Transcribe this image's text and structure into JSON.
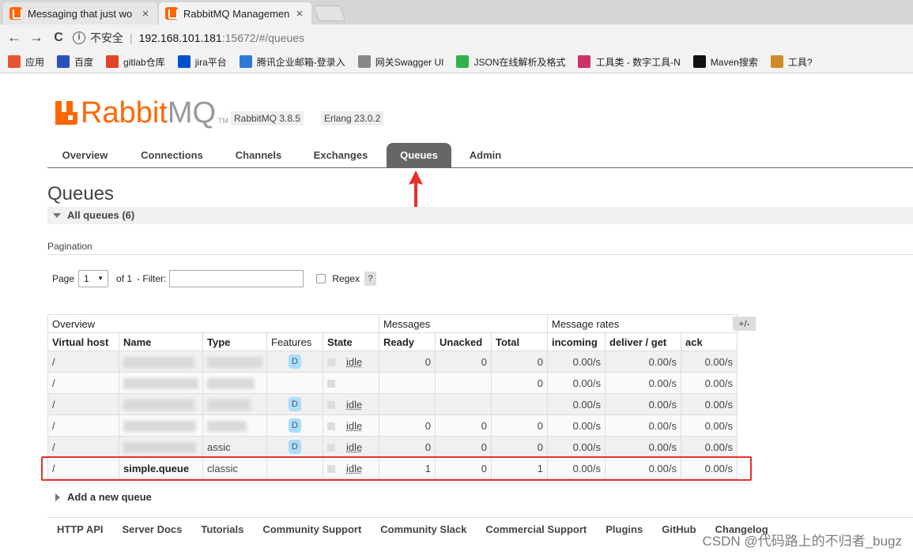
{
  "browser": {
    "tabs": [
      {
        "title": "Messaging that just wo",
        "active": false
      },
      {
        "title": "RabbitMQ Managemen",
        "active": true
      }
    ],
    "close_glyph": "×",
    "nav": {
      "back": "←",
      "forward": "→",
      "reload": "C"
    },
    "address": {
      "insecure_label": "不安全",
      "separator": "|",
      "host": "192.168.101.181",
      "rest": ":15672/#/queues"
    },
    "bookmarks": [
      {
        "label": "应用",
        "icon": "apps-grid-icon",
        "color": "#e8542f"
      },
      {
        "label": "百度",
        "icon": "paw-icon",
        "color": "#2a52be"
      },
      {
        "label": "gitlab仓库",
        "icon": "fox-icon",
        "color": "#e24329"
      },
      {
        "label": "jira平台",
        "icon": "jira-icon",
        "color": "#0052cc"
      },
      {
        "label": "腾讯企业邮箱-登录入",
        "icon": "mail-icon",
        "color": "#2e7bd6"
      },
      {
        "label": "网关Swagger UI",
        "icon": "document-icon",
        "color": "#888888"
      },
      {
        "label": "JSON在线解析及格式",
        "icon": "json-icon",
        "color": "#2fb24c"
      },
      {
        "label": "工具类 - 数字工具-N",
        "icon": "tool-icon",
        "color": "#cc3366"
      },
      {
        "label": "Maven搜索",
        "icon": "source-icon",
        "color": "#111111"
      },
      {
        "label": "工具?",
        "icon": "face-icon",
        "color": "#d08a2a"
      }
    ]
  },
  "app": {
    "brand_rabbit": "Rabbit",
    "brand_mq": "MQ",
    "brand_tm": "TM",
    "version_rabbitmq": "RabbitMQ 3.8.5",
    "version_erlang": "Erlang 23.0.2",
    "nav": [
      {
        "label": "Overview",
        "active": false
      },
      {
        "label": "Connections",
        "active": false
      },
      {
        "label": "Channels",
        "active": false
      },
      {
        "label": "Exchanges",
        "active": false
      },
      {
        "label": "Queues",
        "active": true
      },
      {
        "label": "Admin",
        "active": false
      }
    ],
    "page_title": "Queues",
    "section_title": "All queues (6)",
    "pagination": {
      "label": "Pagination",
      "page_label": "Page",
      "page_value": "1",
      "of_label": "of 1",
      "filter_label": "- Filter:",
      "filter_value": "",
      "regex_label": "Regex",
      "help_label": "?"
    },
    "table": {
      "group_headers": {
        "overview": "Overview",
        "messages": "Messages",
        "rates": "Message rates"
      },
      "columns": [
        "Virtual host",
        "Name",
        "Type",
        "Features",
        "State",
        "Ready",
        "Unacked",
        "Total",
        "incoming",
        "deliver / get",
        "ack"
      ],
      "toggle_label": "+/-",
      "rows": [
        {
          "vhost": "/",
          "name": "",
          "type": "",
          "feature": "D",
          "state": "idle",
          "ready": "0",
          "unacked": "0",
          "total": "0",
          "incoming": "0.00/s",
          "deliver": "0.00/s",
          "ack": "0.00/s"
        },
        {
          "vhost": "/",
          "name": "",
          "type": "",
          "feature": "",
          "state": "",
          "ready": "",
          "unacked": "",
          "total": "0",
          "incoming": "0.00/s",
          "deliver": "0.00/s",
          "ack": "0.00/s"
        },
        {
          "vhost": "/",
          "name": "",
          "type": "",
          "feature": "D",
          "state": "idle",
          "ready": "",
          "unacked": "",
          "total": "",
          "incoming": "0.00/s",
          "deliver": "0.00/s",
          "ack": "0.00/s"
        },
        {
          "vhost": "/",
          "name": "",
          "type": "",
          "feature": "D",
          "state": "idle",
          "ready": "0",
          "unacked": "0",
          "total": "0",
          "incoming": "0.00/s",
          "deliver": "0.00/s",
          "ack": "0.00/s"
        },
        {
          "vhost": "/",
          "name": "",
          "type": "assic",
          "feature": "D",
          "state": "idle",
          "ready": "0",
          "unacked": "0",
          "total": "0",
          "incoming": "0.00/s",
          "deliver": "0.00/s",
          "ack": "0.00/s"
        },
        {
          "vhost": "/",
          "name": "simple.queue",
          "type": "classic",
          "feature": "",
          "state": "idle",
          "ready": "1",
          "unacked": "0",
          "total": "1",
          "incoming": "0.00/s",
          "deliver": "0.00/s",
          "ack": "0.00/s"
        }
      ]
    },
    "add_queue_label": "Add a new queue",
    "footer": [
      "HTTP API",
      "Server Docs",
      "Tutorials",
      "Community Support",
      "Community Slack",
      "Commercial Support",
      "Plugins",
      "GitHub",
      "Changelog"
    ]
  },
  "watermark": "CSDN @代码路上的不归者_bugz",
  "colors": {
    "brand": "#ff6600",
    "nav_active": "#666666",
    "highlight": "#e5302c",
    "arrow": "#e5302c",
    "feature_badge": "#aaddff"
  }
}
